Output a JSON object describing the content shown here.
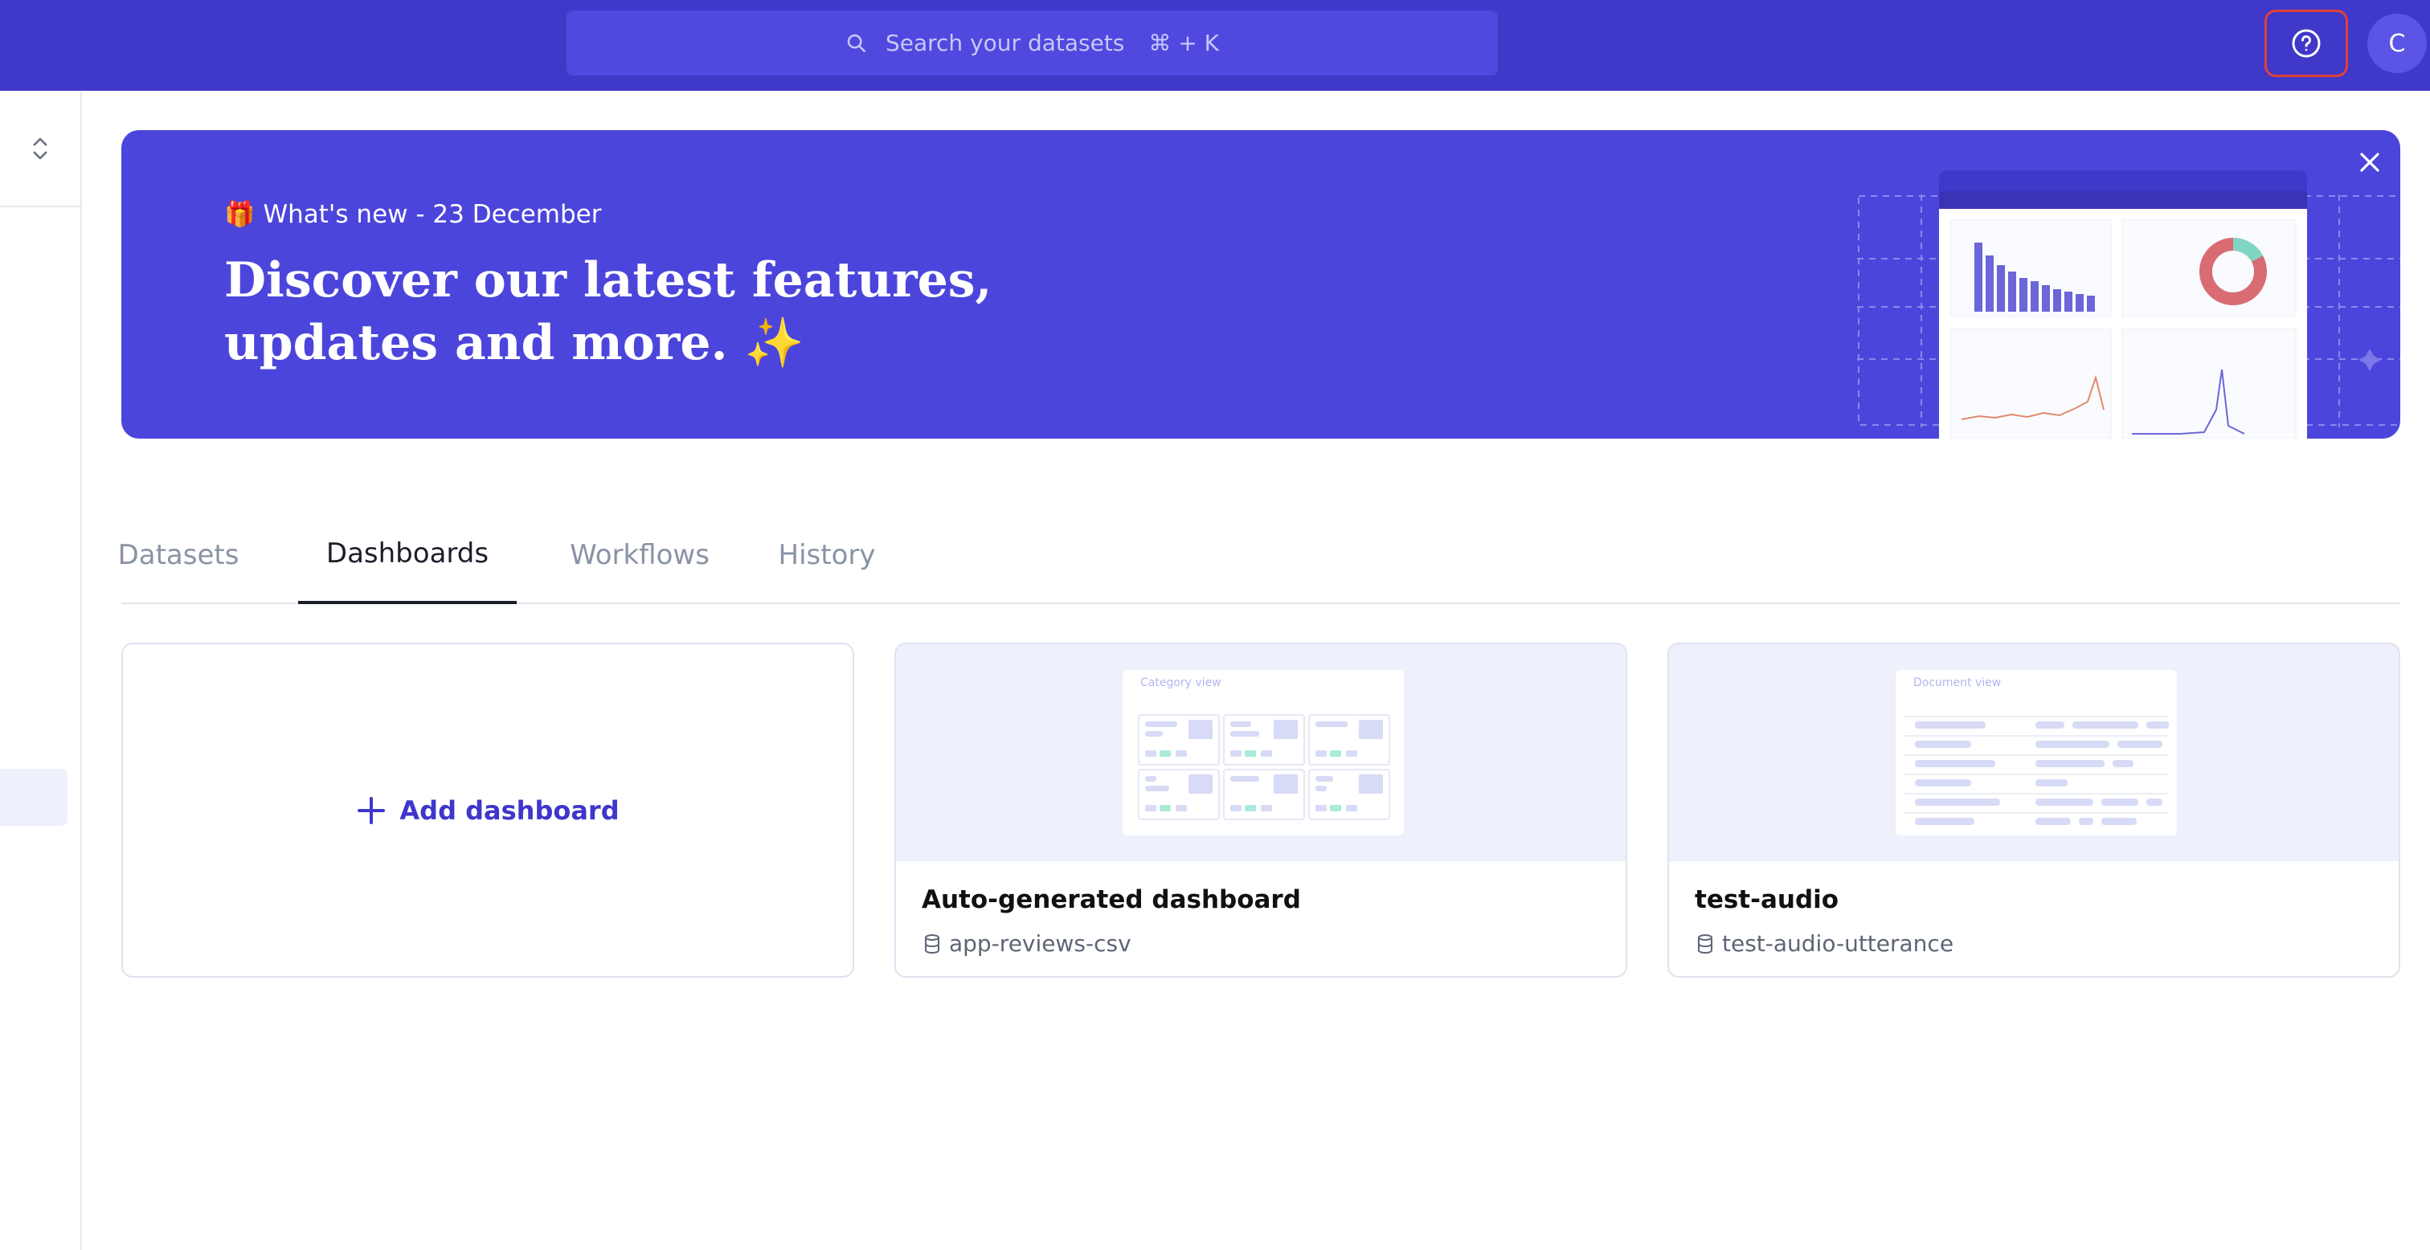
{
  "topbar": {
    "search_placeholder": "Search your datasets",
    "search_shortcut": "⌘ + K",
    "help_icon": "question-circle-icon",
    "avatar_initial": "C"
  },
  "banner": {
    "kicker": "🎁 What's new - 23 December",
    "headline": "Discover our latest features, updates and more. ✨",
    "close_icon": "close-icon"
  },
  "tabs": [
    {
      "label": "Datasets",
      "active": false
    },
    {
      "label": "Dashboards",
      "active": true
    },
    {
      "label": "Workflows",
      "active": false
    },
    {
      "label": "History",
      "active": false
    }
  ],
  "cards": {
    "add_label": "Add dashboard",
    "items": [
      {
        "title": "Auto-generated dashboard",
        "dataset": "app-reviews-csv",
        "preview_label": "Category view"
      },
      {
        "title": "test-audio",
        "dataset": "test-audio-utterance",
        "preview_label": "Document view"
      }
    ]
  },
  "colors": {
    "topbar": "#4038c8",
    "banner": "#4c45dc",
    "accent": "#3f36cc",
    "help_outline": "#e0413a"
  }
}
